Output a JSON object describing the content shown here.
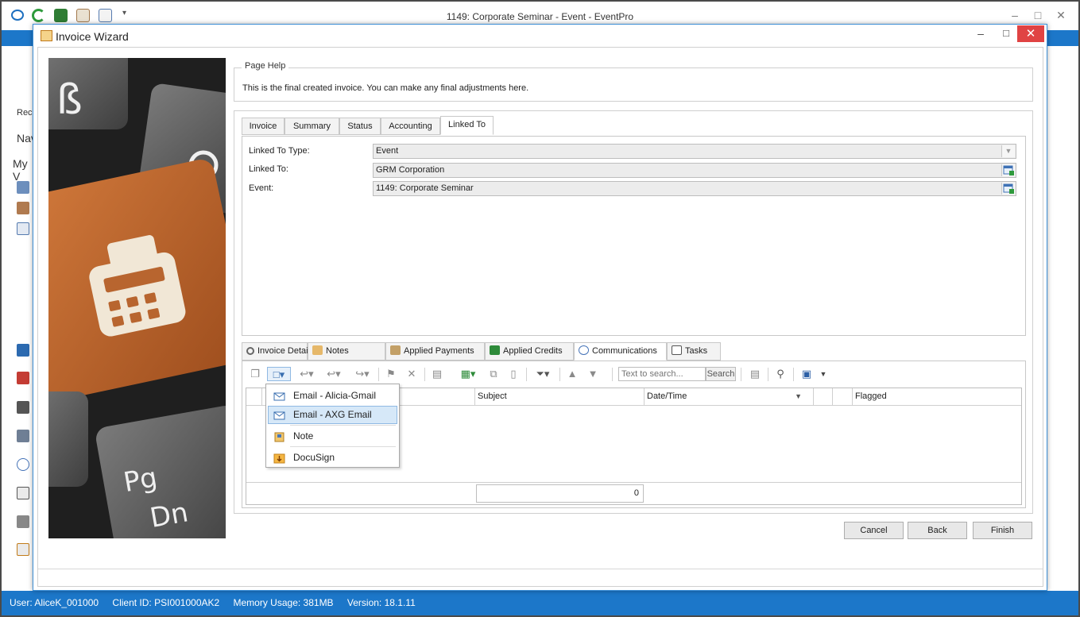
{
  "app": {
    "title": "1149: Corporate Seminar - Event - EventPro",
    "background": {
      "left_labels": [
        "Reco",
        "Nav",
        "My V"
      ]
    }
  },
  "status_bar": {
    "user": "User: AliceK_001000",
    "client_id": "Client ID: PSI001000AK2",
    "memory": "Memory Usage: 381MB",
    "version": "Version: 18.1.11"
  },
  "wizard": {
    "title": "Invoice Wizard",
    "page_help": {
      "legend": "Page Help",
      "text": "This is the final created invoice.  You can make any final adjustments here."
    },
    "tabs": [
      {
        "label": "Invoice"
      },
      {
        "label": "Summary"
      },
      {
        "label": "Status"
      },
      {
        "label": "Accounting"
      },
      {
        "label": "Linked To"
      }
    ],
    "active_tab": "Linked To",
    "linked_to": {
      "type_label": "Linked To Type:",
      "type_value": "Event",
      "linked_label": "Linked To:",
      "linked_value": "GRM Corporation",
      "event_label": "Event:",
      "event_value": "1149: Corporate Seminar"
    },
    "lower_tabs": [
      {
        "label": "Invoice Details",
        "icon": "magnifier-icon"
      },
      {
        "label": "Notes",
        "icon": "notes-icon"
      },
      {
        "label": "Applied Payments",
        "icon": "payments-icon"
      },
      {
        "label": "Applied Credits",
        "icon": "credits-icon"
      },
      {
        "label": "Communications",
        "icon": "speech-bubble-icon"
      },
      {
        "label": "Tasks",
        "icon": "clipboard-icon"
      }
    ],
    "active_lower_tab": "Communications",
    "toolbar": {
      "search_placeholder": "Text to search...",
      "search_button": "Search"
    },
    "grid": {
      "columns": [
        {
          "label": ""
        },
        {
          "label": ""
        },
        {
          "label": "Subject"
        },
        {
          "label": "Date/Time"
        },
        {
          "label": ""
        },
        {
          "label": ""
        },
        {
          "label": "Flagged"
        }
      ],
      "count": "0"
    },
    "new_menu": {
      "items": [
        {
          "label": "Email - Alicia-Gmail",
          "icon": "envelope-icon"
        },
        {
          "label": "Email - AXG Email",
          "icon": "envelope-icon"
        },
        {
          "label": "Note",
          "icon": "note-icon"
        },
        {
          "label": "DocuSign",
          "icon": "docusign-icon"
        }
      ],
      "hovered": "Email - AXG Email"
    },
    "buttons": {
      "cancel": "Cancel",
      "back": "Back",
      "finish": "Finish"
    },
    "colors": {
      "accent": "#1c77c9",
      "close": "#e04343",
      "menu_hover": "#d6e8f8",
      "key_orange": "#c3692c"
    }
  }
}
